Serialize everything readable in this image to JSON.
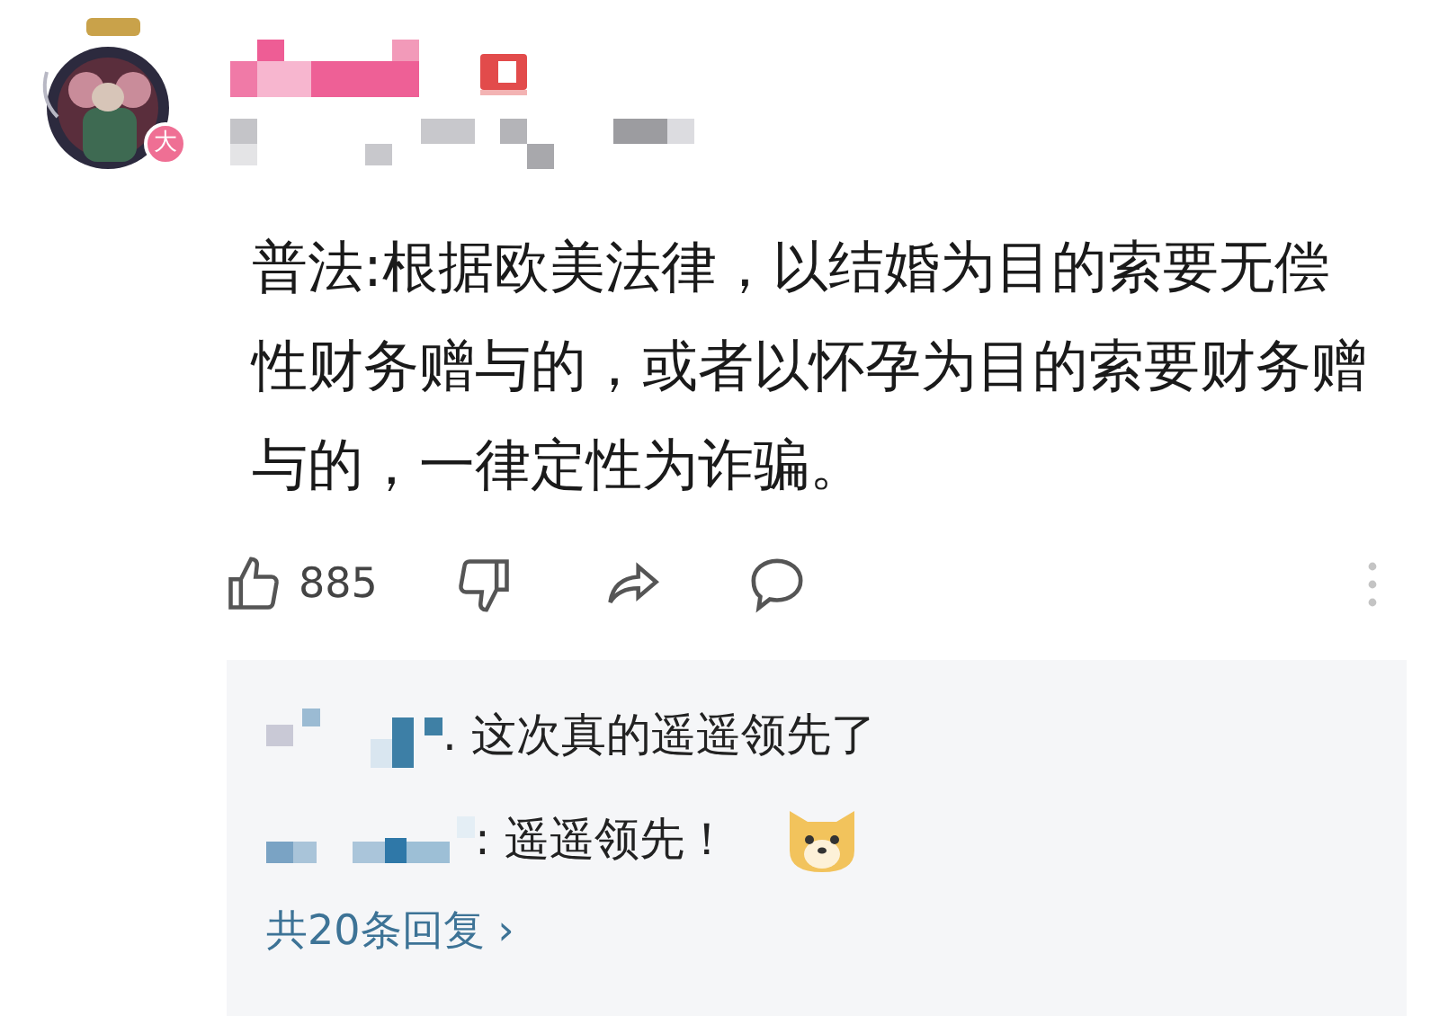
{
  "comment": {
    "avatar_badge": "大",
    "body": "普法:根据欧美法律，以结婚为目的索要无偿性财务赠与的，或者以怀孕为目的索要财务赠与的，一律定性为诈骗。",
    "likes": "885"
  },
  "replies": [
    {
      "text": ". 这次真的遥遥领先了",
      "emoji": false
    },
    {
      "text": ": 遥遥领先！",
      "emoji": true
    }
  ],
  "more_replies": "共20条回复 ›"
}
